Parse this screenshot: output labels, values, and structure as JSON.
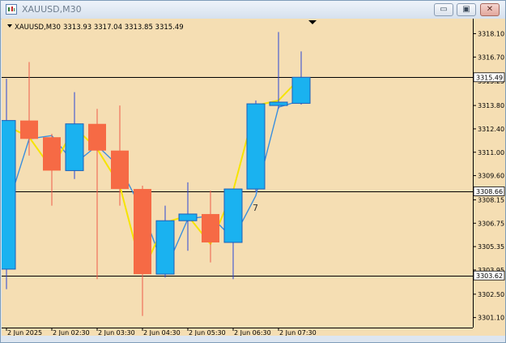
{
  "window": {
    "title": "XAUUSD,M30",
    "controls": {
      "minimize": "▭",
      "restore": "▣",
      "close": "✕"
    }
  },
  "chart": {
    "symbol_header": "XAUUSD,M30",
    "ohlc_header": "3313.93 3317.04 3313.85 3315.49",
    "marker_text": "7",
    "colors": {
      "background": "#f5deb3",
      "bull_body": "#1ab2f0",
      "bull_border": "#1d5fb8",
      "bear_body": "#f66a45",
      "wick_bull": "#2a46d6",
      "wick_bear": "#f05a4a",
      "ma_fast": "#f6e400",
      "ma_slow": "#3a8fde",
      "hline": "#000000"
    }
  },
  "chart_data": {
    "type": "candlestick",
    "ylim": [
      3300.5,
      3319.0
    ],
    "y_ticks": [
      "3318.10",
      "3316.70",
      "3315.25",
      "3313.80",
      "3312.40",
      "3311.00",
      "3309.60",
      "3308.15",
      "3306.75",
      "3305.35",
      "3303.95",
      "3302.50",
      "3301.10"
    ],
    "x_labels": [
      "2 Jun 2025",
      "2 Jun 02:30",
      "2 Jun 03:30",
      "2 Jun 04:30",
      "2 Jun 05:30",
      "2 Jun 06:30",
      "2 Jun 07:30"
    ],
    "price_labels": [
      {
        "value": 3315.49,
        "text": "3315.49"
      },
      {
        "value": 3308.66,
        "text": "3308.66"
      },
      {
        "value": 3303.62,
        "text": "3303.62"
      }
    ],
    "candles": [
      {
        "open": 3304.0,
        "high": 3315.4,
        "low": 3302.8,
        "close": 3312.9,
        "dir": "up"
      },
      {
        "open": 3312.9,
        "high": 3316.4,
        "low": 3310.8,
        "close": 3311.8,
        "dir": "down"
      },
      {
        "open": 3311.9,
        "high": 3312.1,
        "low": 3307.8,
        "close": 3309.9,
        "dir": "down"
      },
      {
        "open": 3309.9,
        "high": 3314.6,
        "low": 3309.4,
        "close": 3312.7,
        "dir": "up"
      },
      {
        "open": 3312.7,
        "high": 3313.6,
        "low": 3303.4,
        "close": 3311.1,
        "dir": "down"
      },
      {
        "open": 3311.1,
        "high": 3313.8,
        "low": 3307.8,
        "close": 3308.8,
        "dir": "down"
      },
      {
        "open": 3308.8,
        "high": 3309.0,
        "low": 3301.2,
        "close": 3303.7,
        "dir": "down"
      },
      {
        "open": 3303.7,
        "high": 3307.8,
        "low": 3303.5,
        "close": 3306.9,
        "dir": "up"
      },
      {
        "open": 3306.9,
        "high": 3309.2,
        "low": 3305.1,
        "close": 3307.3,
        "dir": "up"
      },
      {
        "open": 3307.3,
        "high": 3308.7,
        "low": 3304.4,
        "close": 3305.6,
        "dir": "down"
      },
      {
        "open": 3305.6,
        "high": 3308.8,
        "low": 3303.4,
        "close": 3308.8,
        "dir": "up"
      },
      {
        "open": 3308.8,
        "high": 3314.1,
        "low": 3308.6,
        "close": 3313.9,
        "dir": "up"
      },
      {
        "open": 3313.8,
        "high": 3318.2,
        "low": 3313.6,
        "close": 3314.0,
        "dir": "up"
      },
      {
        "open": 3313.93,
        "high": 3317.04,
        "low": 3313.85,
        "close": 3315.49,
        "dir": "up"
      }
    ],
    "ma_fast": [
      3312.6,
      3311.9,
      3310.0,
      3312.5,
      3311.2,
      3309.0,
      3303.8,
      3306.8,
      3307.2,
      3305.5,
      3308.7,
      3313.8,
      3314.1,
      3315.5
    ],
    "ma_slow": [
      3307.5,
      3311.8,
      3312.0,
      3310.3,
      3311.4,
      3310.1,
      3307.5,
      3303.9,
      3307.0,
      3307.2,
      3305.8,
      3308.4,
      3313.7,
      3314.1
    ]
  }
}
